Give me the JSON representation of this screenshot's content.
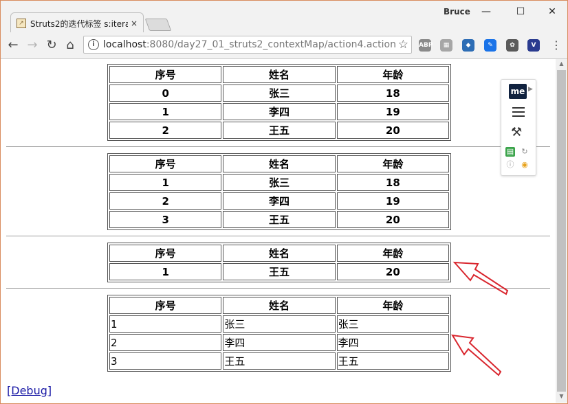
{
  "window": {
    "user_name": "Bruce",
    "minimize_glyph": "—",
    "maximize_glyph": "☐",
    "close_glyph": "✕"
  },
  "tab": {
    "title": "Struts2的迭代标签 s:itera",
    "close_glyph": "×",
    "favicon_glyph": "↗"
  },
  "toolbar": {
    "back_glyph": "←",
    "forward_glyph": "→",
    "reload_glyph": "↻",
    "home_glyph": "⌂",
    "url_host": "localhost",
    "url_rest": ":8080/day27_01_struts2_contextMap/action4.action",
    "bookmark_glyph": "☆",
    "menu_glyph": "⋮",
    "extensions": [
      {
        "name": "adblock-plus-icon",
        "label": "ABP",
        "color": "#8a8a8a"
      },
      {
        "name": "grid-icon",
        "label": "▦",
        "color": "#a6a6a6"
      },
      {
        "name": "graduation-cap-icon",
        "label": "◆",
        "color": "#2d6db5"
      },
      {
        "name": "edit-square-icon",
        "label": "✎",
        "color": "#1a73e8"
      },
      {
        "name": "evernote-icon",
        "label": "✿",
        "color": "#5a5a5a"
      },
      {
        "name": "v-shield-icon",
        "label": "V",
        "color": "#2a3b8f"
      }
    ]
  },
  "tables": {
    "headers": [
      "序号",
      "姓名",
      "年龄"
    ],
    "table1": [
      [
        "0",
        "张三",
        "18"
      ],
      [
        "1",
        "李四",
        "19"
      ],
      [
        "2",
        "王五",
        "20"
      ]
    ],
    "table2": [
      [
        "1",
        "张三",
        "18"
      ],
      [
        "2",
        "李四",
        "19"
      ],
      [
        "3",
        "王五",
        "20"
      ]
    ],
    "table3": [
      [
        "1",
        "王五",
        "20"
      ]
    ],
    "table4": [
      [
        "1",
        "张三",
        "张三"
      ],
      [
        "2",
        "李四",
        "李四"
      ],
      [
        "3",
        "王五",
        "王五"
      ]
    ]
  },
  "debug_link": "[Debug]",
  "side_panel": {
    "logo_text": "me",
    "arrow_glyph": "▶",
    "wand_glyph": "⚒",
    "refresh_glyph": "↻",
    "info_glyph": "ⓘ",
    "eye_glyph": "◉"
  },
  "colors": {
    "annotation_arrow": "#d9262e",
    "link": "#1a1aa6"
  }
}
